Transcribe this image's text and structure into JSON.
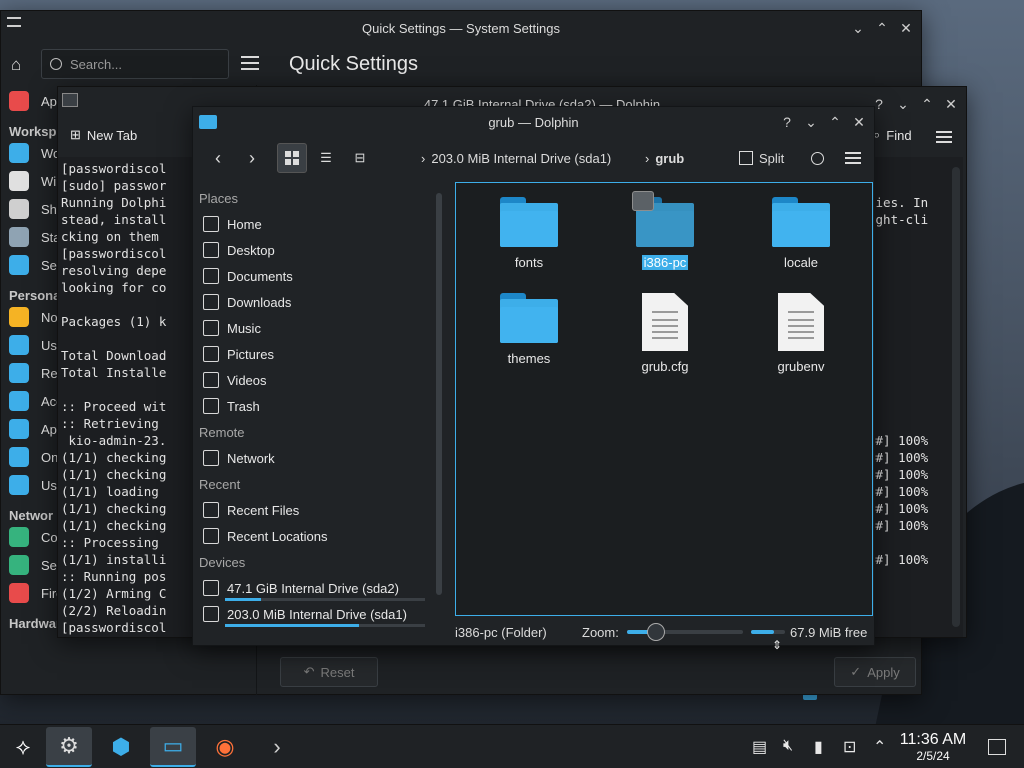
{
  "system_settings": {
    "title": "Quick Settings — System Settings",
    "page_title": "Quick Settings",
    "search_placeholder": "Search...",
    "sidebar": [
      {
        "type": "item",
        "label": "Ap",
        "icon": "appearance-icon",
        "color": "#e84b4b"
      },
      {
        "type": "header",
        "label": "Worksp"
      },
      {
        "type": "item",
        "label": "Wo",
        "icon": "workspace-behavior-icon",
        "color": "#3daee9"
      },
      {
        "type": "item",
        "label": "Wi",
        "icon": "window-management-icon",
        "color": "#e0e0e0"
      },
      {
        "type": "item",
        "label": "Sh",
        "icon": "shortcuts-icon",
        "color": "#cfcfcf"
      },
      {
        "type": "item",
        "label": "Sta",
        "icon": "startup-icon",
        "color": "#8fa3b3"
      },
      {
        "type": "item",
        "label": "Sea",
        "icon": "search-settings-icon",
        "color": "#3daee9"
      },
      {
        "type": "header",
        "label": "Persona"
      },
      {
        "type": "item",
        "label": "No",
        "icon": "notifications-icon",
        "color": "#f5b324"
      },
      {
        "type": "item",
        "label": "Use",
        "icon": "users-icon",
        "color": "#3daee9"
      },
      {
        "type": "item",
        "label": "Re",
        "icon": "regional-icon",
        "color": "#3daee9"
      },
      {
        "type": "item",
        "label": "Acc",
        "icon": "accessibility-icon",
        "color": "#3daee9"
      },
      {
        "type": "item",
        "label": "Ap",
        "icon": "applications-icon",
        "color": "#3daee9"
      },
      {
        "type": "item",
        "label": "On",
        "icon": "online-accounts-icon",
        "color": "#3daee9"
      },
      {
        "type": "item",
        "label": "Use",
        "icon": "user-feedback-icon",
        "color": "#3daee9"
      },
      {
        "type": "header",
        "label": "Networ"
      },
      {
        "type": "item",
        "label": "Co",
        "icon": "connections-icon",
        "color": "#36b37e"
      },
      {
        "type": "item",
        "label": "Set",
        "icon": "network-settings-icon",
        "color": "#36b37e"
      },
      {
        "type": "item",
        "label": "Firewall",
        "icon": "firewall-icon",
        "color": "#e84b4b"
      },
      {
        "type": "header",
        "label": "Hardware"
      }
    ],
    "reset_label": "Reset",
    "apply_label": "Apply"
  },
  "dolphin_back": {
    "title": "47.1 GiB Internal Drive (sda2) — Dolphin",
    "new_tab_label": "New Tab",
    "find_label": "Find",
    "terminal_left": [
      "[passwordiscol",
      "[sudo] passwor",
      "Running Dolphi",
      "stead, install",
      "cking on them ",
      "[passwordiscol",
      "resolving depe",
      "looking for co",
      "",
      "Packages (1) k",
      "",
      "Total Download",
      "Total Installe",
      "",
      ":: Proceed wit",
      ":: Retrieving ",
      " kio-admin-23.",
      "(1/1) checking",
      "(1/1) checking",
      "(1/1) loading ",
      "(1/1) checking",
      "(1/1) checking",
      ":: Processing ",
      "(1/1) installi",
      ":: Running pos",
      "(1/2) Arming C",
      "(2/2) Reloadin",
      "[passwordiscol"
    ],
    "terminal_right": [
      "",
      "",
      "ties. In",
      "ight-cli",
      "",
      "",
      "",
      "",
      "",
      "",
      "",
      "",
      "",
      "",
      "",
      "",
      "##] 100%",
      "##] 100%",
      "##] 100%",
      "##] 100%",
      "##] 100%",
      "##] 100%",
      "",
      "##] 100%"
    ]
  },
  "dolphin": {
    "title": "grub — Dolphin",
    "breadcrumb_parent": "203.0 MiB Internal Drive (sda1)",
    "breadcrumb_current": "grub",
    "split_label": "Split",
    "places_header": "Places",
    "places": [
      {
        "label": "Home",
        "icon": "home-icon"
      },
      {
        "label": "Desktop",
        "icon": "desktop-icon"
      },
      {
        "label": "Documents",
        "icon": "documents-icon"
      },
      {
        "label": "Downloads",
        "icon": "downloads-icon"
      },
      {
        "label": "Music",
        "icon": "music-icon"
      },
      {
        "label": "Pictures",
        "icon": "pictures-icon"
      },
      {
        "label": "Videos",
        "icon": "videos-icon"
      },
      {
        "label": "Trash",
        "icon": "trash-icon"
      }
    ],
    "remote_header": "Remote",
    "remote": [
      {
        "label": "Network",
        "icon": "network-icon"
      }
    ],
    "recent_header": "Recent",
    "recent": [
      {
        "label": "Recent Files",
        "icon": "recent-files-icon"
      },
      {
        "label": "Recent Locations",
        "icon": "recent-locations-icon"
      }
    ],
    "devices_header": "Devices",
    "devices": [
      {
        "label": "47.1 GiB Internal Drive (sda2)",
        "usage": 0.18
      },
      {
        "label": "203.0 MiB Internal Drive (sda1)",
        "usage": 0.67
      }
    ],
    "files": [
      {
        "name": "fonts",
        "kind": "folder"
      },
      {
        "name": "i386-pc",
        "kind": "folder",
        "selected": true
      },
      {
        "name": "locale",
        "kind": "folder"
      },
      {
        "name": "themes",
        "kind": "folder"
      },
      {
        "name": "grub.cfg",
        "kind": "file"
      },
      {
        "name": "grubenv",
        "kind": "file"
      }
    ],
    "status_text": "i386-pc (Folder)",
    "zoom_label": "Zoom:",
    "zoom_level": 0.25,
    "free_space": "67.9 MiB free",
    "free_fraction": 0.67
  },
  "taskbar": {
    "clock_time": "11:36 AM",
    "clock_date": "2/5/24",
    "apps": [
      {
        "name": "application-launcher-icon"
      },
      {
        "name": "system-settings-icon",
        "active": true
      },
      {
        "name": "discover-icon"
      },
      {
        "name": "dolphin-icon",
        "active": true
      },
      {
        "name": "firefox-icon"
      },
      {
        "name": "konsole-icon"
      }
    ]
  }
}
